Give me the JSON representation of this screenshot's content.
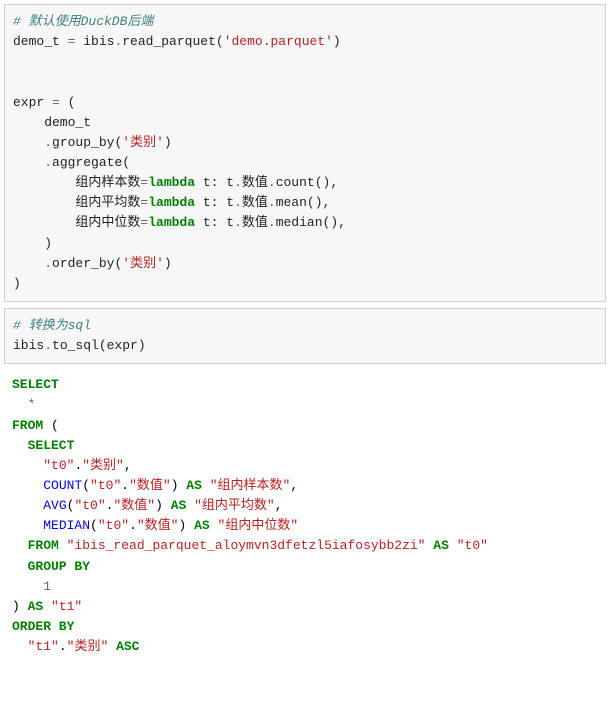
{
  "cell1": {
    "comment": "# 默认使用DuckDB后端",
    "line2_a": "demo_t ",
    "line2_b": "=",
    "line2_c": " ibis",
    "line2_d": ".",
    "line2_e": "read_parquet",
    "line2_f": "(",
    "line2_g": "'demo.parquet'",
    "line2_h": ")",
    "line4_a": "expr ",
    "line4_b": "=",
    "line4_c": " (",
    "line5": "    demo_t",
    "line6_a": "    ",
    "line6_b": ".",
    "line6_c": "group_by",
    "line6_d": "(",
    "line6_e": "'类别'",
    "line6_f": ")",
    "line7_a": "    ",
    "line7_b": ".",
    "line7_c": "aggregate",
    "line7_d": "(",
    "line8_a": "        组内样本数",
    "line8_b": "=",
    "line8_c": "lambda",
    "line8_d": " t: t",
    "line8_e": ".",
    "line8_f": "数值",
    "line8_g": ".",
    "line8_h": "count",
    "line8_i": "(),",
    "line9_a": "        组内平均数",
    "line9_b": "=",
    "line9_c": "lambda",
    "line9_d": " t: t",
    "line9_e": ".",
    "line9_f": "数值",
    "line9_g": ".",
    "line9_h": "mean",
    "line9_i": "(),",
    "line10_a": "        组内中位数",
    "line10_b": "=",
    "line10_c": "lambda",
    "line10_d": " t: t",
    "line10_e": ".",
    "line10_f": "数值",
    "line10_g": ".",
    "line10_h": "median",
    "line10_i": "(),",
    "line11": "    )",
    "line12_a": "    ",
    "line12_b": ".",
    "line12_c": "order_by",
    "line12_d": "(",
    "line12_e": "'类别'",
    "line12_f": ")",
    "line13": ")"
  },
  "cell2": {
    "comment": "# 转换为sql",
    "line2_a": "ibis",
    "line2_b": ".",
    "line2_c": "to_sql",
    "line2_d": "(expr)"
  },
  "output": {
    "l1": "SELECT",
    "l2": "  *",
    "l3a": "FROM",
    "l3b": " (",
    "l4": "  SELECT",
    "l5a": "    ",
    "l5b": "\"t0\"",
    "l5c": ".",
    "l5d": "\"类别\"",
    "l5e": ",",
    "l6a": "    ",
    "l6b": "COUNT",
    "l6c": "(",
    "l6d": "\"t0\"",
    "l6e": ".",
    "l6f": "\"数值\"",
    "l6g": ") ",
    "l6h": "AS",
    "l6i": " ",
    "l6j": "\"组内样本数\"",
    "l6k": ",",
    "l7a": "    ",
    "l7b": "AVG",
    "l7c": "(",
    "l7d": "\"t0\"",
    "l7e": ".",
    "l7f": "\"数值\"",
    "l7g": ") ",
    "l7h": "AS",
    "l7i": " ",
    "l7j": "\"组内平均数\"",
    "l7k": ",",
    "l8a": "    ",
    "l8b": "MEDIAN",
    "l8c": "(",
    "l8d": "\"t0\"",
    "l8e": ".",
    "l8f": "\"数值\"",
    "l8g": ") ",
    "l8h": "AS",
    "l8i": " ",
    "l8j": "\"组内中位数\"",
    "l9a": "  FROM",
    "l9b": " ",
    "l9c": "\"ibis_read_parquet_aloymvn3dfetzl5iafosybb2zi\"",
    "l9d": " ",
    "l9e": "AS",
    "l9f": " ",
    "l9g": "\"t0\"",
    "l10": "  GROUP BY",
    "l11a": "    ",
    "l11b": "1",
    "l12a": ") ",
    "l12b": "AS",
    "l12c": " ",
    "l12d": "\"t1\"",
    "l13": "ORDER BY",
    "l14a": "  ",
    "l14b": "\"t1\"",
    "l14c": ".",
    "l14d": "\"类别\"",
    "l14e": " ",
    "l14f": "ASC"
  }
}
